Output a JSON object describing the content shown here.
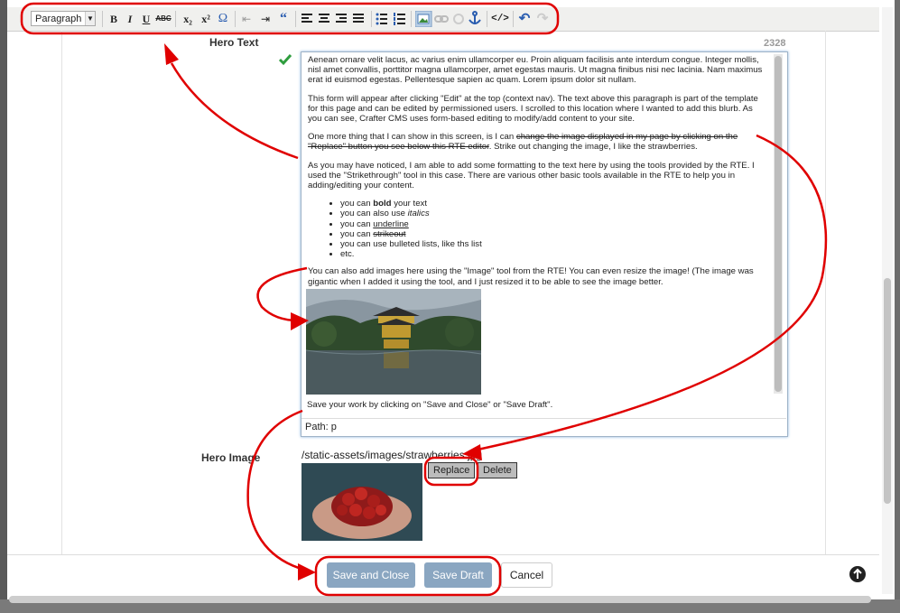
{
  "toolbar": {
    "format_select": "Paragraph",
    "bold": "B",
    "italic": "I",
    "underline": "U",
    "strikethrough": "ABC",
    "subscript": "x₂",
    "superscript": "x²",
    "special_char": "Ω",
    "outdent": "⇤",
    "indent": "⇥",
    "blockquote": "“",
    "source_code": "</>",
    "undo": "↶",
    "redo": "↷"
  },
  "form": {
    "hero_text_label": "Hero Text",
    "char_count": "2328",
    "hero_image_label": "Hero Image",
    "image_path": "/static-assets/images/strawberries.jpg",
    "replace_label": "Replace",
    "delete_label": "Delete"
  },
  "editor": {
    "p1": "Aenean ornare velit lacus, ac varius enim ullamcorper eu. Proin aliquam facilisis ante interdum congue. Integer mollis, nisl amet convallis, porttitor magna ullamcorper, amet egestas mauris. Ut magna finibus nisi nec lacinia. Nam maximus erat id euismod egestas. Pellentesque sapien ac quam. Lorem ipsum dolor sit nullam.",
    "p2": "This form will appear after clicking \"Edit\" at the top (context nav).  The text above this paragraph is part of the template for this page and can be edited by permissioned users.  I scrolled to this location where I wanted to add this blurb.  As you can see, Crafter CMS uses form-based editing to modify/add content to your site.",
    "p3a": "One more thing that I can show in this screen, is I can ",
    "p3_strike": "change the image displayed in my page by clicking on the \"Replace\" button you see below this RTE editor",
    "p3b": ".  Strike out changing the image, I like the strawberries.",
    "p4": "As you may have noticed, I am able to add some formatting to the text here by using the tools provided by the RTE.  I used the \"Strikethrough\" tool in this case.  There are various other basic tools available in the RTE to help you in adding/editing your content.",
    "li1a": "you can ",
    "li1b": "bold",
    "li1c": " your text",
    "li2a": "you can also use ",
    "li2b": "italics",
    "li3a": "you can ",
    "li3b": "underline",
    "li4a": "you can ",
    "li4b": "strikeout",
    "li5": "you can use bulleted lists, like ths list",
    "li6": "etc.",
    "p5": "You can also add images here using the \"Image\" tool from the RTE!  You can even resize the image! (The image was gigantic when I added it using the tool, and I just resized it to be able to see the image better.",
    "p6": "Save your work by clicking on \"Save and Close\" or \"Save Draft\".",
    "path": "Path: p"
  },
  "footer": {
    "save_close": "Save and Close",
    "save_draft": "Save Draft",
    "cancel": "Cancel"
  },
  "colors": {
    "primary_button": "#8aa6c1",
    "annotation": "#e00000",
    "check": "#2e9d3e"
  }
}
